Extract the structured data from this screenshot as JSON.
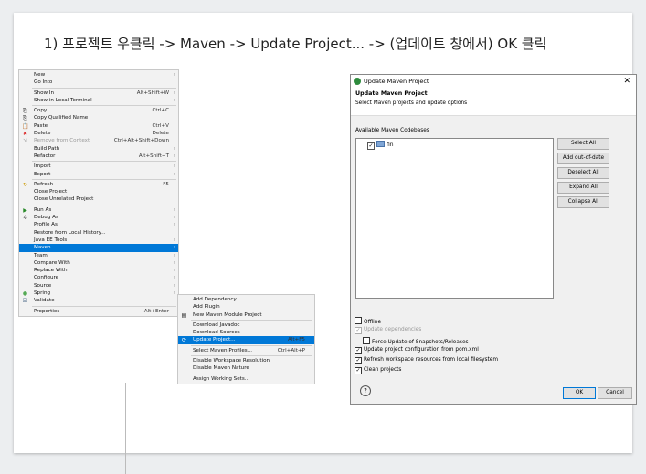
{
  "heading": "1)  프로젝트 우클릭 -> Maven -> Update Project... -> (업데이트 창에서) OK 클릭",
  "context_menu": {
    "items": [
      {
        "label": "New",
        "shortcut": "",
        "arrow": "›"
      },
      {
        "label": "Go Into",
        "shortcut": "",
        "arrow": ""
      },
      {
        "sep": true
      },
      {
        "label": "Show In",
        "shortcut": "Alt+Shift+W",
        "arrow": "›"
      },
      {
        "label": "Show in Local Terminal",
        "shortcut": "",
        "arrow": "›"
      },
      {
        "sep": true
      },
      {
        "label": "Copy",
        "shortcut": "Ctrl+C",
        "arrow": "",
        "icon": "copy-icon",
        "glyph": "⎘"
      },
      {
        "label": "Copy Qualified Name",
        "shortcut": "",
        "arrow": "",
        "icon": "copy-qualified-icon",
        "glyph": "⎘"
      },
      {
        "label": "Paste",
        "shortcut": "Ctrl+V",
        "arrow": "",
        "icon": "paste-icon",
        "glyph": "📋"
      },
      {
        "label": "Delete",
        "shortcut": "Delete",
        "arrow": "",
        "icon": "delete-icon",
        "glyph": "✖",
        "color": "#d33"
      },
      {
        "label": "Remove from Context",
        "shortcut": "Ctrl+Alt+Shift+Down",
        "arrow": "",
        "disabled": true,
        "icon": "remove-context-icon",
        "glyph": "⇲"
      },
      {
        "label": "Build Path",
        "shortcut": "",
        "arrow": "›"
      },
      {
        "label": "Refactor",
        "shortcut": "Alt+Shift+T",
        "arrow": "›"
      },
      {
        "sep": true
      },
      {
        "label": "Import",
        "shortcut": "",
        "arrow": "›"
      },
      {
        "label": "Export",
        "shortcut": "",
        "arrow": "›"
      },
      {
        "sep": true
      },
      {
        "label": "Refresh",
        "shortcut": "F5",
        "arrow": "",
        "icon": "refresh-icon",
        "glyph": "↻",
        "color": "#c90"
      },
      {
        "label": "Close Project",
        "shortcut": "",
        "arrow": ""
      },
      {
        "label": "Close Unrelated Project",
        "shortcut": "",
        "arrow": ""
      },
      {
        "sep": true
      },
      {
        "label": "Run As",
        "shortcut": "",
        "arrow": "›",
        "icon": "run-icon",
        "glyph": "▶",
        "color": "#2a8a2a"
      },
      {
        "label": "Debug As",
        "shortcut": "",
        "arrow": "›",
        "icon": "debug-icon",
        "glyph": "✲",
        "color": "#666"
      },
      {
        "label": "Profile As",
        "shortcut": "",
        "arrow": "›"
      },
      {
        "label": "Restore from Local History...",
        "shortcut": "",
        "arrow": ""
      },
      {
        "label": "Java EE Tools",
        "shortcut": "",
        "arrow": "›"
      },
      {
        "label": "Maven",
        "shortcut": "",
        "arrow": "›",
        "selected": true
      },
      {
        "label": "Team",
        "shortcut": "",
        "arrow": "›"
      },
      {
        "label": "Compare With",
        "shortcut": "",
        "arrow": "›"
      },
      {
        "label": "Replace With",
        "shortcut": "",
        "arrow": "›"
      },
      {
        "label": "Configure",
        "shortcut": "",
        "arrow": "›"
      },
      {
        "label": "Source",
        "shortcut": "",
        "arrow": "›"
      },
      {
        "label": "Spring",
        "shortcut": "",
        "arrow": "›",
        "icon": "spring-icon",
        "glyph": "●",
        "color": "#5a5"
      },
      {
        "label": "Validate",
        "shortcut": "",
        "arrow": "",
        "icon": "validate-icon",
        "glyph": "☑",
        "color": "#357"
      },
      {
        "sep": true
      },
      {
        "label": "Properties",
        "shortcut": "Alt+Enter",
        "arrow": ""
      }
    ]
  },
  "maven_submenu": {
    "items": [
      {
        "label": "Add Dependency",
        "shortcut": ""
      },
      {
        "label": "Add Plugin",
        "shortcut": ""
      },
      {
        "label": "New Maven Module Project",
        "shortcut": "",
        "icon": "module-icon",
        "glyph": "▤"
      },
      {
        "sep": true
      },
      {
        "label": "Download Javadoc",
        "shortcut": ""
      },
      {
        "label": "Download Sources",
        "shortcut": ""
      },
      {
        "label": "Update Project...",
        "shortcut": "Alt+F5",
        "selected": true,
        "icon": "update-project-icon",
        "glyph": "⟳"
      },
      {
        "sep": true
      },
      {
        "label": "Select Maven Profiles...",
        "shortcut": "Ctrl+Alt+P"
      },
      {
        "sep": true
      },
      {
        "label": "Disable Workspace Resolution",
        "shortcut": ""
      },
      {
        "label": "Disable Maven Nature",
        "shortcut": ""
      },
      {
        "sep": true
      },
      {
        "label": "Assign Working Sets...",
        "shortcut": ""
      }
    ]
  },
  "dialog": {
    "window_title": "Update Maven Project",
    "close_glyph": "✕",
    "header_title": "Update Maven Project",
    "header_desc": "Select Maven projects and update options",
    "codebases_label": "Available Maven Codebases",
    "project_name": "fin",
    "buttons": {
      "select_all": "Select All",
      "add_out_of_date": "Add out-of-date",
      "deselect_all": "Deselect All",
      "expand_all": "Expand All",
      "collapse_all": "Collapse All",
      "ok": "OK",
      "cancel": "Cancel"
    },
    "options": [
      {
        "label": "Offline",
        "checked": false,
        "disabled": false,
        "indent": false
      },
      {
        "label": "Update dependencies",
        "checked": true,
        "disabled": true,
        "indent": false
      },
      {
        "label": "Force Update of Snapshots/Releases",
        "checked": false,
        "disabled": false,
        "indent": true
      },
      {
        "label": "Update project configuration from pom.xml",
        "checked": true,
        "disabled": false,
        "indent": false
      },
      {
        "label": "Refresh workspace resources from local filesystem",
        "checked": true,
        "disabled": false,
        "indent": false
      },
      {
        "label": "Clean projects",
        "checked": true,
        "disabled": false,
        "indent": false
      }
    ],
    "help_glyph": "?"
  }
}
